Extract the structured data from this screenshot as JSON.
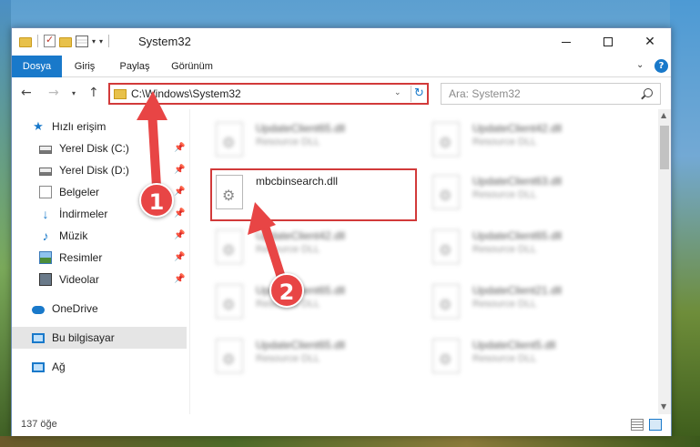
{
  "window": {
    "title": "System32",
    "quick_access_caret": "▾"
  },
  "ribbon": {
    "tabs": [
      "Dosya",
      "Giriş",
      "Paylaş",
      "Görünüm"
    ],
    "help": "?"
  },
  "navbar": {
    "address": "C:\\Windows\\System32",
    "search_placeholder": "Ara: System32"
  },
  "sidebar": {
    "items": [
      {
        "label": "Hızlı erişim",
        "icon": "star-icon",
        "pinned": false
      },
      {
        "label": "Yerel Disk (C:)",
        "icon": "disk-icon",
        "pinned": true
      },
      {
        "label": "Yerel Disk (D:)",
        "icon": "disk-icon",
        "pinned": true
      },
      {
        "label": "Belgeler",
        "icon": "documents-icon",
        "pinned": true
      },
      {
        "label": "İndirmeler",
        "icon": "download-icon",
        "pinned": true
      },
      {
        "label": "Müzik",
        "icon": "music-icon",
        "pinned": true
      },
      {
        "label": "Resimler",
        "icon": "pictures-icon",
        "pinned": true
      },
      {
        "label": "Videolar",
        "icon": "videos-icon",
        "pinned": true
      },
      {
        "label": "OneDrive",
        "icon": "onedrive-icon",
        "pinned": false
      },
      {
        "label": "Bu bilgisayar",
        "icon": "pc-icon",
        "pinned": false,
        "selected": true
      },
      {
        "label": "Ağ",
        "icon": "network-icon",
        "pinned": false
      }
    ]
  },
  "files": [
    {
      "name": "UpdateClient65.dll",
      "desc": "Resource DLL",
      "blurred": true
    },
    {
      "name": "UpdateClient42.dll",
      "desc": "Resource DLL",
      "blurred": true
    },
    {
      "name": "mbcbinsearch.dll",
      "desc": "",
      "blurred": false,
      "highlighted": true
    },
    {
      "name": "UpdateClient63.dll",
      "desc": "Resource DLL",
      "blurred": true
    },
    {
      "name": "UpdateClient42.dll",
      "desc": "Resource DLL",
      "blurred": true
    },
    {
      "name": "UpdateClient65.dll",
      "desc": "Resource DLL",
      "blurred": true
    },
    {
      "name": "UpdateClient65.dll",
      "desc": "Resource DLL",
      "blurred": true
    },
    {
      "name": "UpdateClient21.dll",
      "desc": "Resource DLL",
      "blurred": true
    },
    {
      "name": "UpdateClient65.dll",
      "desc": "Resource DLL",
      "blurred": true
    },
    {
      "name": "UpdateClient5.dll",
      "desc": "Resource DLL",
      "blurred": true
    }
  ],
  "status": {
    "count": "137 öğe"
  },
  "annotations": {
    "badge1": "1",
    "badge2": "2",
    "color": "#e84545"
  }
}
